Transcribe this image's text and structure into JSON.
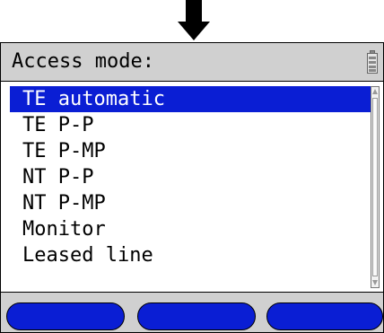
{
  "header": {
    "title": "Access mode:",
    "battery_icon": "battery-icon"
  },
  "menu": {
    "items": [
      {
        "label": "TE automatic",
        "selected": true
      },
      {
        "label": "TE P-P",
        "selected": false
      },
      {
        "label": "TE P-MP",
        "selected": false
      },
      {
        "label": "NT P-P",
        "selected": false
      },
      {
        "label": "NT P-MP",
        "selected": false
      },
      {
        "label": "Monitor",
        "selected": false
      },
      {
        "label": "Leased line",
        "selected": false
      }
    ]
  },
  "softkeys": [
    {
      "label": ""
    },
    {
      "label": ""
    },
    {
      "label": ""
    }
  ],
  "indicator_icon": "down-arrow-icon",
  "colors": {
    "highlight": "#0a1ed4",
    "background": "#d0d0d0",
    "list_background": "#ffffff"
  }
}
